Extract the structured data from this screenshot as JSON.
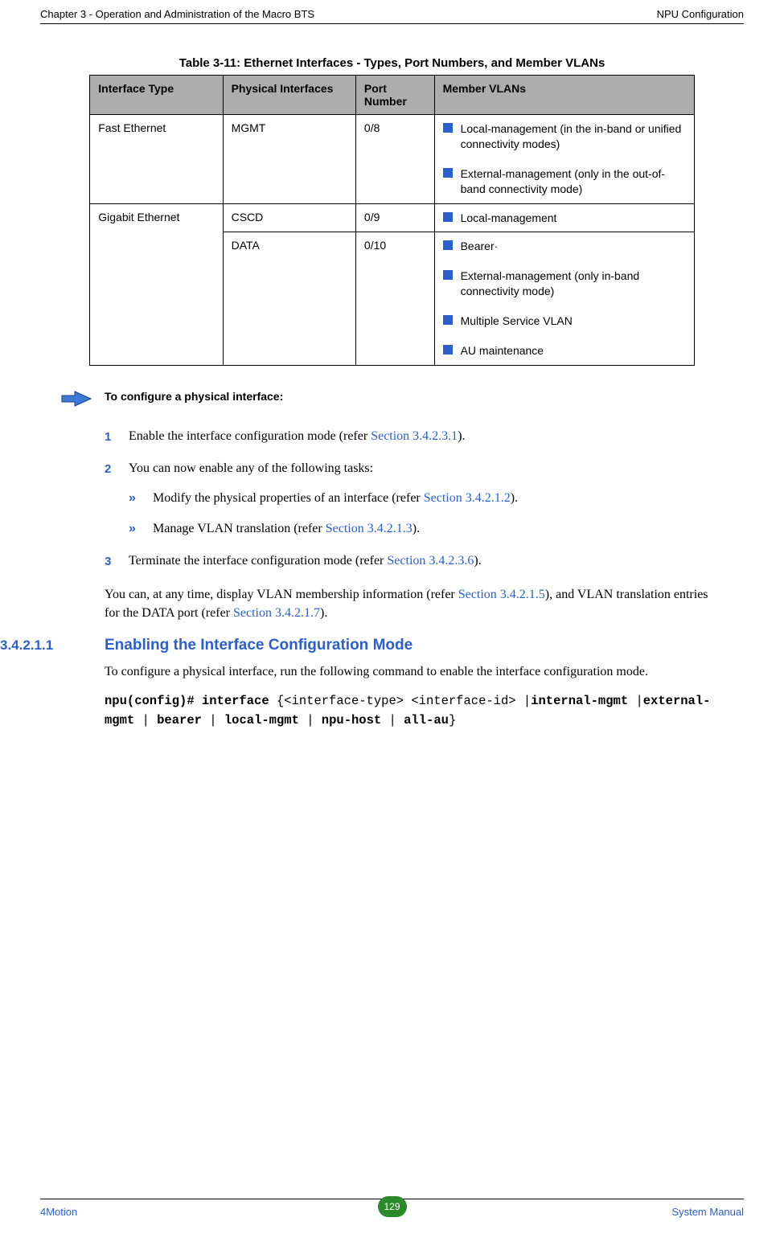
{
  "header": {
    "left": "Chapter 3 - Operation and Administration of the Macro BTS",
    "right": "NPU Configuration"
  },
  "table": {
    "caption": "Table 3-11: Ethernet Interfaces - Types, Port Numbers, and Member VLANs",
    "columns": [
      "Interface Type",
      "Physical Interfaces",
      "Port Number",
      "Member VLANs"
    ],
    "rows": [
      {
        "interface_type": "Fast Ethernet",
        "physical": "MGMT",
        "port": "0/8",
        "vlans": [
          "Local-management (in the in-band or unified connectivity modes)",
          "External-management (only in the out-of-band connectivity mode)"
        ]
      },
      {
        "interface_type": "Gigabit Ethernet",
        "rowspan": 2,
        "physical": "CSCD",
        "port": "0/9",
        "vlans": [
          "Local-management"
        ]
      },
      {
        "physical": "DATA",
        "port": "0/10",
        "vlans": [
          "Bearer·",
          "External-management (only in-band connectivity mode)",
          "Multiple Service VLAN",
          "AU maintenance"
        ]
      }
    ]
  },
  "procedure": {
    "label": "To configure a physical interface:",
    "steps": [
      {
        "num": "1",
        "text_pre": "Enable the interface configuration mode (refer ",
        "link": "Section 3.4.2.3.1",
        "text_post": ")."
      },
      {
        "num": "2",
        "text_pre": "You can now enable any of the following tasks:",
        "subs": [
          {
            "pre": "Modify the physical properties of an interface (refer ",
            "link": "Section 3.4.2.1.2",
            "post": ")."
          },
          {
            "pre": "Manage VLAN translation (refer ",
            "link": "Section 3.4.2.1.3",
            "post": ")."
          }
        ]
      },
      {
        "num": "3",
        "text_pre": "Terminate the interface configuration mode (refer ",
        "link": "Section 3.4.2.3.6",
        "text_post": ")."
      }
    ],
    "tail_para": {
      "p1": "You can, at any time, display VLAN membership information (refer ",
      "link1": "Section 3.4.2.1.5",
      "p2": "), and VLAN translation entries for the DATA port (refer ",
      "link2": "Section 3.4.2.1.7",
      "p3": ")."
    }
  },
  "heading": {
    "num": "3.4.2.1.1",
    "text": "Enabling the Interface Configuration Mode"
  },
  "intro_para": "To configure a physical interface, run the following command to enable the interface configuration mode.",
  "command": {
    "part1": "npu(config)# interface ",
    "part2": "{<interface-type> <interface-id> |",
    "part3": "internal-mgmt ",
    "part4": "|",
    "part5": "external-mgmt ",
    "part6": "| ",
    "part7": "bearer ",
    "part8": "| ",
    "part9": "local-mgmt ",
    "part10": "| ",
    "part11": "npu-host ",
    "part12": "| ",
    "part13": "all-au",
    "part14": "}"
  },
  "footer": {
    "left": "4Motion",
    "page": "129",
    "right": "System Manual"
  }
}
